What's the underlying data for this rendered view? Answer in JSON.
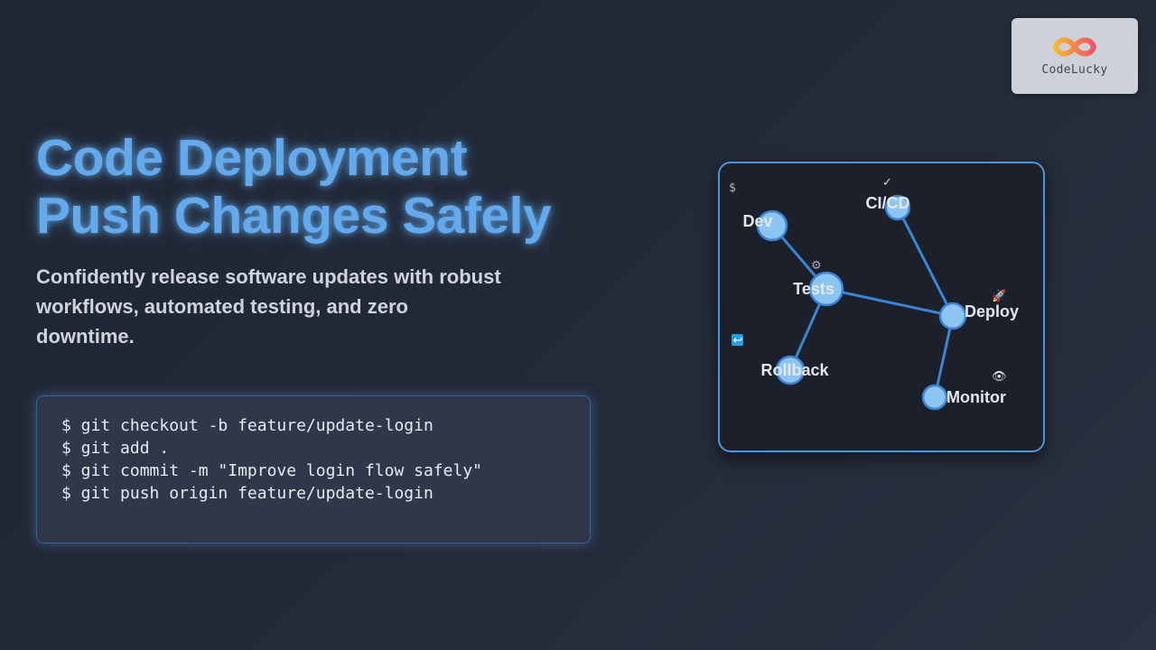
{
  "logo": {
    "text": "CodeLucky",
    "icon": "infinity-logo-icon"
  },
  "hero": {
    "title_line1": "Code Deployment",
    "title_line2": "Push Changes Safely",
    "subtitle": "Confidently release software updates with robust workflows, automated testing, and zero downtime."
  },
  "code": {
    "lines": [
      "$ git checkout -b feature/update-login",
      "$ git add .",
      "$ git commit -m \"Improve login flow safely\"",
      "$ git push origin feature/update-login"
    ]
  },
  "diagram": {
    "nodes": {
      "dev": "Dev",
      "cicd": "CI/CD",
      "tests": "Tests",
      "deploy": "Deploy",
      "rollback": "Rollback",
      "monitor": "Monitor"
    },
    "glyphs": {
      "terminal": "$",
      "check": "✓",
      "gear": "⚙",
      "rocket": "🚀",
      "rollback": "↩",
      "eye": "👁"
    }
  },
  "colors": {
    "accent": "#63a9ec",
    "node_fill": "#8cc4f2",
    "node_stroke": "#3b82d6",
    "edge": "#3a86d4"
  }
}
